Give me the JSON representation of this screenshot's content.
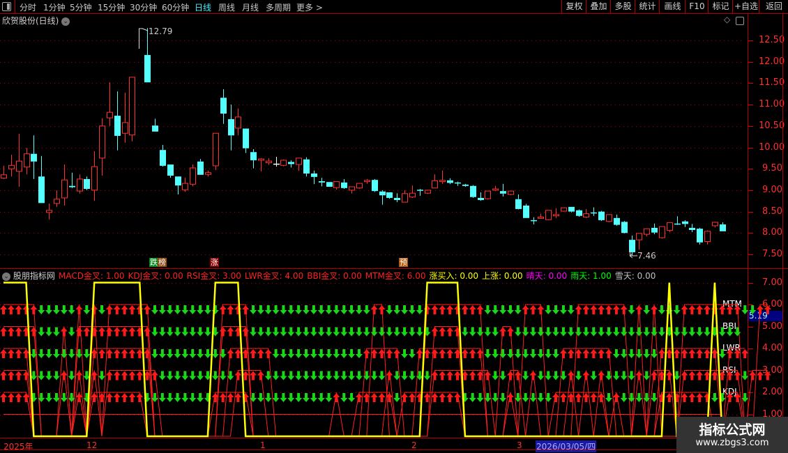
{
  "toolbar": {
    "periods": [
      "分时",
      "1分钟",
      "5分钟",
      "15分钟",
      "30分钟",
      "60分钟",
      "日线",
      "周线",
      "月线",
      "多周期",
      "更多 >"
    ],
    "active_period": "日线",
    "buttons": [
      "复权",
      "叠加",
      "多股",
      "统计",
      "画线",
      "F10",
      "标记",
      "+自选",
      "返回"
    ]
  },
  "main": {
    "title": "欣贺股份(日线)",
    "price_axis": [
      "12.50",
      "12.00",
      "11.50",
      "11.00",
      "10.50",
      "10.00",
      "9.50",
      "9.00",
      "8.50",
      "8.00",
      "7.50"
    ],
    "high_label": "12.79",
    "low_label": "7.46",
    "badges": [
      {
        "text": "跌",
        "color": "#0a8a1a"
      },
      {
        "text": "榜",
        "color": "#8b4a14"
      },
      {
        "text": "涨",
        "color": "#8b0000"
      },
      {
        "text": "预",
        "color": "#b45a10"
      }
    ],
    "colors": {
      "up": "#ff3232",
      "down": "#54ffff",
      "doji": "#ffffff",
      "grid": "#b00000"
    }
  },
  "chart_data": {
    "type": "candlestick",
    "ylim": [
      7.3,
      12.9
    ],
    "candles": [
      [
        9.28,
        9.36,
        9.57,
        9.26
      ],
      [
        9.5,
        9.58,
        9.83,
        9.32
      ],
      [
        9.44,
        9.68,
        10.32,
        9.08
      ],
      [
        9.54,
        9.85,
        9.99,
        9.37
      ],
      [
        9.85,
        9.67,
        10.28,
        9.26
      ],
      [
        9.32,
        8.7,
        9.8,
        8.7
      ],
      [
        8.48,
        8.53,
        8.69,
        8.31
      ],
      [
        8.69,
        8.79,
        9.0,
        8.61
      ],
      [
        8.82,
        9.24,
        9.6,
        8.64
      ],
      [
        9.1,
        9.07,
        9.41,
        9.05
      ],
      [
        8.98,
        9.26,
        9.37,
        8.92
      ],
      [
        9.26,
        9.03,
        9.32,
        9.0
      ],
      [
        9.0,
        9.55,
        9.91,
        8.75
      ],
      [
        9.75,
        10.5,
        10.68,
        9.34
      ],
      [
        10.69,
        10.82,
        11.52,
        10.5
      ],
      [
        10.74,
        10.27,
        11.31,
        9.93
      ],
      [
        10.33,
        10.58,
        11.28,
        10.11
      ],
      [
        10.29,
        11.64,
        11.64,
        10.14
      ],
      null,
      [
        12.16,
        11.52,
        12.79,
        11.52
      ],
      [
        10.51,
        10.37,
        10.67,
        10.37
      ],
      [
        9.94,
        9.57,
        10.06,
        9.55
      ],
      [
        9.6,
        9.34,
        9.6,
        9.29
      ],
      [
        9.32,
        9.11,
        9.32,
        8.9
      ],
      [
        9.01,
        9.16,
        9.29,
        8.96
      ],
      [
        9.14,
        9.52,
        9.6,
        9.09
      ],
      [
        9.67,
        9.36,
        9.73,
        9.36
      ],
      [
        9.37,
        9.41,
        9.46,
        9.32
      ],
      [
        9.57,
        10.33,
        10.33,
        9.47
      ],
      [
        11.16,
        10.79,
        11.36,
        10.55
      ],
      [
        10.66,
        10.28,
        11.0,
        9.93
      ],
      [
        10.45,
        10.71,
        10.91,
        10.28
      ],
      [
        10.44,
        9.98,
        10.44,
        9.87
      ],
      [
        9.89,
        9.7,
        9.96,
        9.51
      ],
      [
        9.7,
        9.73,
        9.75,
        9.44
      ],
      [
        9.64,
        9.68,
        9.75,
        9.59
      ],
      [
        9.62,
        9.62,
        9.78,
        9.55
      ],
      [
        9.58,
        9.7,
        9.72,
        9.56
      ],
      [
        9.66,
        9.61,
        9.7,
        9.53
      ],
      [
        9.6,
        9.75,
        9.75,
        9.45
      ],
      [
        9.72,
        9.39,
        9.77,
        9.32
      ],
      [
        9.39,
        9.31,
        9.46,
        9.14
      ],
      [
        9.21,
        9.18,
        9.29,
        9.09
      ],
      [
        9.19,
        9.08,
        9.19,
        9.08
      ],
      [
        9.06,
        9.2,
        9.2,
        9.01
      ],
      [
        9.18,
        9.05,
        9.26,
        9.03
      ],
      [
        9.0,
        9.08,
        9.08,
        8.92
      ],
      [
        9.05,
        9.16,
        9.16,
        9.03
      ],
      [
        9.2,
        9.23,
        9.26,
        9.15
      ],
      [
        9.24,
        8.98,
        9.26,
        8.96
      ],
      [
        8.97,
        8.88,
        9.0,
        8.66
      ],
      [
        8.95,
        8.82,
        8.95,
        8.8
      ],
      [
        8.82,
        8.77,
        8.93,
        8.72
      ],
      [
        8.72,
        8.92,
        9.0,
        8.72
      ],
      [
        8.84,
        8.93,
        9.11,
        8.82
      ],
      [
        9.01,
        9.0,
        9.03,
        8.87
      ],
      [
        8.93,
        9.0,
        9.0,
        8.91
      ],
      [
        9.05,
        9.22,
        9.37,
        9.05
      ],
      [
        9.2,
        9.23,
        9.46,
        9.15
      ],
      [
        9.23,
        9.17,
        9.28,
        9.14
      ],
      [
        9.18,
        9.16,
        9.2,
        9.1
      ],
      [
        9.13,
        9.1,
        9.15,
        9.08
      ],
      [
        9.1,
        8.84,
        9.12,
        8.82
      ],
      [
        8.82,
        8.77,
        8.95,
        8.75
      ],
      [
        8.8,
        8.98,
        8.98,
        8.78
      ],
      [
        9.0,
        9.03,
        9.1,
        8.98
      ],
      [
        8.98,
        8.92,
        9.15,
        8.85
      ],
      [
        8.9,
        8.98,
        8.99,
        8.88
      ],
      [
        8.79,
        8.56,
        8.9,
        8.55
      ],
      [
        8.64,
        8.35,
        8.68,
        8.35
      ],
      [
        8.3,
        8.29,
        8.37,
        8.2
      ],
      [
        8.34,
        8.37,
        8.45,
        8.33
      ],
      [
        8.31,
        8.53,
        8.53,
        8.3
      ],
      [
        8.4,
        8.43,
        8.58,
        8.35
      ],
      [
        8.51,
        8.59,
        8.6,
        8.5
      ],
      [
        8.61,
        8.5,
        8.61,
        8.48
      ],
      [
        8.53,
        8.4,
        8.55,
        8.38
      ],
      [
        8.37,
        8.45,
        8.56,
        8.35
      ],
      [
        8.48,
        8.47,
        8.6,
        8.4
      ],
      [
        8.5,
        8.3,
        8.52,
        8.28
      ],
      [
        8.27,
        8.43,
        8.43,
        8.25
      ],
      [
        8.35,
        8.19,
        8.43,
        8.17
      ],
      [
        8.26,
        8.0,
        8.28,
        7.99
      ],
      [
        7.84,
        7.55,
        7.94,
        7.46
      ],
      [
        7.84,
        7.99,
        7.99,
        7.61
      ],
      [
        7.97,
        8.1,
        8.1,
        7.92
      ],
      [
        8.12,
        8.01,
        8.22,
        7.97
      ],
      [
        7.89,
        8.15,
        8.15,
        7.87
      ],
      [
        8.06,
        8.24,
        8.24,
        8.02
      ],
      [
        8.22,
        8.21,
        8.39,
        8.19
      ],
      [
        8.27,
        8.21,
        8.3,
        8.14
      ],
      [
        8.12,
        8.07,
        8.21,
        8.02
      ],
      [
        8.1,
        7.78,
        8.12,
        7.73
      ],
      [
        7.8,
        8.04,
        8.06,
        7.73
      ],
      [
        8.17,
        8.25,
        8.26,
        8.13
      ],
      [
        8.2,
        8.04,
        8.25,
        8.04
      ]
    ]
  },
  "indicator": {
    "name": "股朋指标网",
    "header": [
      {
        "text": "MACD金叉: 1.00",
        "color": "#ff2020"
      },
      {
        "text": "KDJ金叉: 0.00",
        "color": "#ff2020"
      },
      {
        "text": "RSI金叉: 3.00",
        "color": "#ff2020"
      },
      {
        "text": "LWR金叉: 4.00",
        "color": "#ff2020"
      },
      {
        "text": "BBI金叉: 0.00",
        "color": "#ff2020"
      },
      {
        "text": "MTM金叉: 6.00",
        "color": "#ff2020"
      },
      {
        "text": "涨买入: 0.00",
        "color": "#ffff00"
      },
      {
        "text": "上涨: 0.00",
        "color": "#ffff00"
      },
      {
        "text": "晴天: 0.00",
        "color": "#ff00ff"
      },
      {
        "text": "雨天: 1.00",
        "color": "#00ff00"
      },
      {
        "text": "雪天: 0.00",
        "color": "#c0c0c0"
      }
    ],
    "axis": [
      "7.00",
      "6.00",
      "5.00",
      "4.00",
      "3.00",
      "2.00",
      "1.00"
    ],
    "cursor_value": "5.19",
    "ylim": [
      0,
      7.2
    ],
    "rows": [
      {
        "label": "MTM",
        "level": 6,
        "signals": "uuuuudddddududuuuuuuddddddddduuuudddddddddddddddduuddddduuuuuuuuddddduuudddduuuuuuudududdduuuuuuuudduu"
      },
      {
        "label": "BBI",
        "level": 5,
        "signals": "uuuuuddduduuuuuuuuuuddddddddduuuudddddddddddddddddddddddduuuuddddduudddddddddddddddddddddddddddddd"
      },
      {
        "label": "LWR",
        "level": 4,
        "signals": "uuuudddddddduuuuuuuudddddddddduuuuuudddddddddddduuuuudduuuuuuuuudddddddddduuuuuuudddddduuuuuuuuduuu"
      },
      {
        "label": "RSI",
        "level": 3,
        "signals": "uuuuddddudududuuuuuuudddddddddduuuudddddddddddddddduddddduuuuuuuudduududdddudududddduduuuduuuuuuuuduuu"
      },
      {
        "label": "KDJ",
        "level": 2,
        "signals": "uuuudddddduduuuuuuuddddddddduuuuudddddddddddudduuuuuduuuuuuuudddddduddddduuuuuuududdddduuuuuuudduud"
      }
    ],
    "yellow_line": [
      7,
      7,
      7,
      7,
      0,
      0,
      0,
      0,
      0,
      0,
      0,
      0,
      7,
      7,
      7,
      7,
      7,
      7,
      7,
      0,
      0,
      0,
      0,
      0,
      0,
      0,
      0,
      0,
      7,
      7,
      7,
      7,
      0,
      0,
      0,
      0,
      0,
      0,
      0,
      0,
      0,
      0,
      0,
      0,
      0,
      0,
      0,
      0,
      0,
      0,
      0,
      0,
      0,
      0,
      0,
      0,
      7,
      7,
      7,
      7,
      7,
      0,
      0,
      0,
      0,
      0,
      0,
      0,
      0,
      0,
      0,
      0,
      0,
      0,
      0,
      0,
      0,
      0,
      0,
      0,
      0,
      0,
      0,
      0,
      0,
      0,
      0,
      0,
      7,
      0,
      0,
      0,
      0,
      0,
      7,
      0
    ]
  },
  "dates": {
    "labels": [
      "2025年",
      "12",
      "1",
      "2",
      "3"
    ],
    "cursor_date": "2026/03/05/四"
  },
  "watermark": {
    "title": "指标公式网",
    "url": "www.zbgs3.com"
  }
}
